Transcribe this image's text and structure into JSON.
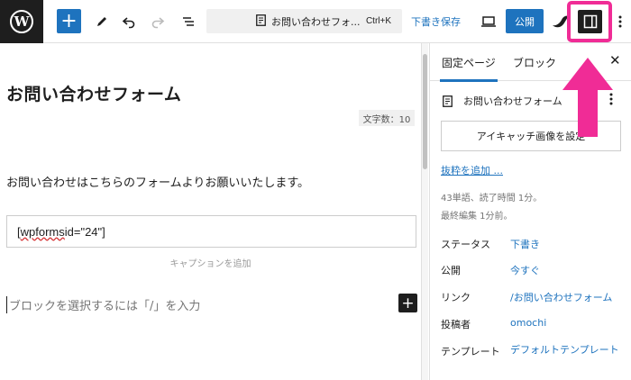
{
  "toolbar": {
    "document_title": "お問い合わせフォ...",
    "shortcut": "Ctrl+K",
    "save_draft": "下書き保存",
    "publish": "公開"
  },
  "editor": {
    "page_title": "お問い合わせフォーム",
    "word_count": "文字数：10",
    "paragraph": "お問い合わせはこちらのフォームよりお願いいたします。",
    "shortcode_prefix": "[",
    "shortcode_misspelled": "wpforms",
    "shortcode_rest": " id=\"24\"]",
    "caption_placeholder": "キャプションを追加",
    "block_placeholder": "ブロックを選択するには「/」を入力"
  },
  "sidebar": {
    "tabs": [
      {
        "label": "固定ページ",
        "active": true
      },
      {
        "label": "ブロック",
        "active": false
      }
    ],
    "doc_label": "お問い合わせフォーム",
    "featured_image_button": "アイキャッチ画像を設定",
    "excerpt_link": "抜粋を追加 ...",
    "meta_words": "43単語、読了時間 1分。",
    "meta_edited": "最終編集 1分前。",
    "properties": [
      {
        "label": "ステータス",
        "value": "下書き"
      },
      {
        "label": "公開",
        "value": "今すぐ"
      },
      {
        "label": "リンク",
        "value": "/お問い合わせフォーム"
      },
      {
        "label": "投稿者",
        "value": "omochi"
      },
      {
        "label": "テンプレート",
        "value": "デフォルトテンプレート"
      }
    ]
  },
  "colors": {
    "accent": "#1e73be",
    "highlight": "#f02c96",
    "dark": "#1e1e1e"
  },
  "icons": [
    "wordpress-logo-icon",
    "plus-icon",
    "pencil-icon",
    "undo-icon",
    "redo-icon",
    "list-view-icon",
    "page-icon",
    "desktop-preview-icon",
    "jetpack-icon",
    "sidebar-toggle-icon",
    "more-vertical-icon",
    "close-icon"
  ]
}
